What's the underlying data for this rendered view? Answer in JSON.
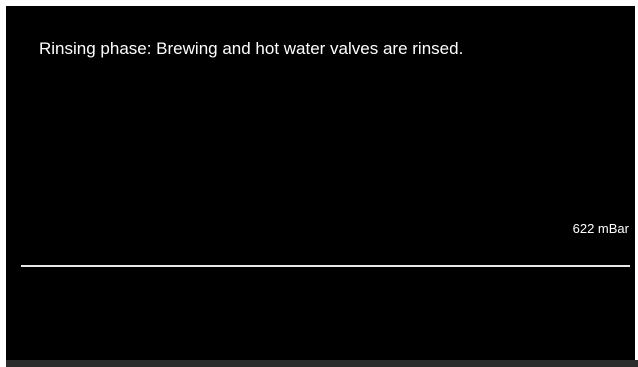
{
  "display": {
    "status_message": "Rinsing phase: Brewing and hot water valves are rinsed.",
    "pressure_readout": "622 mBar"
  },
  "colors": {
    "screen_background": "#000000",
    "text": "#ffffff",
    "divider": "#e8e8e8",
    "bottom_bar": "#2b2b2b"
  }
}
